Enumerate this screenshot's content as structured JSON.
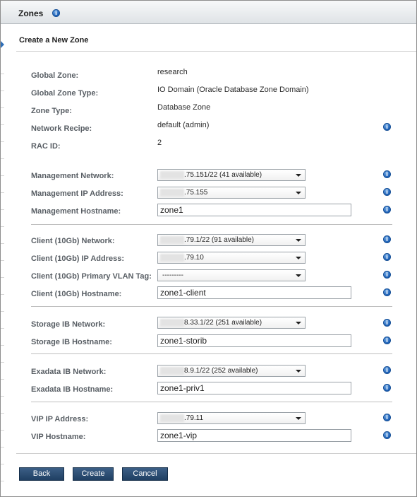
{
  "window": {
    "title": "Zones"
  },
  "panel": {
    "title": "Create a New Zone"
  },
  "summary": [
    {
      "label": "Global Zone:",
      "value": "research"
    },
    {
      "label": "Global Zone Type:",
      "value": "IO Domain (Oracle Database Zone Domain)"
    },
    {
      "label": "Zone Type:",
      "value": "Database Zone"
    },
    {
      "label": "Network Recipe:",
      "value": "default (admin)"
    },
    {
      "label": "RAC ID:",
      "value": "2"
    }
  ],
  "management": {
    "network_label": "Management Network:",
    "network_value": ".75.151/22 (41 available)",
    "ip_label": "Management IP Address:",
    "ip_value": ".75.155",
    "hostname_label": "Management Hostname:",
    "hostname_value": "zone1"
  },
  "client": {
    "network_label": "Client (10Gb) Network:",
    "network_value": ".79.1/22 (91 available)",
    "ip_label": "Client (10Gb) IP Address:",
    "ip_value": ".79.10",
    "vlan_label": "Client (10Gb) Primary VLAN Tag:",
    "vlan_value": "---------",
    "hostname_label": "Client (10Gb) Hostname:",
    "hostname_value": "zone1-client"
  },
  "storage": {
    "network_label": "Storage IB Network:",
    "network_value": "8.33.1/22 (251 available)",
    "hostname_label": "Storage IB Hostname:",
    "hostname_value": "zone1-storib"
  },
  "exadata": {
    "network_label": "Exadata IB Network:",
    "network_value": "8.9.1/22 (252 available)",
    "hostname_label": "Exadata IB Hostname:",
    "hostname_value": "zone1-priv1"
  },
  "vip": {
    "ip_label": "VIP IP Address:",
    "ip_value": ".79.11",
    "hostname_label": "VIP Hostname:",
    "hostname_value": "zone1-vip"
  },
  "buttons": {
    "back": "Back",
    "create": "Create",
    "cancel": "Cancel"
  },
  "icons": {
    "help": "info-icon",
    "info_glyph": "i",
    "dropdown": "chevron-down-icon"
  },
  "colors": {
    "button_bg": "#2b4c72",
    "label": "#585e64",
    "info_blue": "#1c5fb5"
  }
}
